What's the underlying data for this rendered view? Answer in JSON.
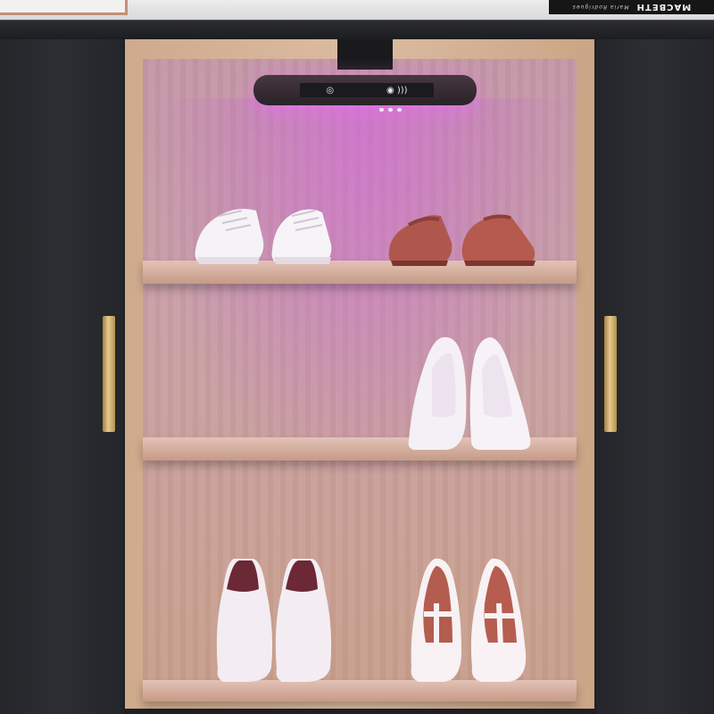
{
  "book": {
    "title": "MACBETH",
    "subtitle": "Maria Rodrigues"
  },
  "lamp": {
    "left_icon": "power-icon",
    "right_icon": "signal-icon",
    "left_glyph": "◎",
    "right_glyph": "◉ )))"
  },
  "colors": {
    "uv_light": "#d65ce6",
    "door": "#2a2b30",
    "wood": "#d4b29a",
    "handle": "#d4b173"
  },
  "shelves": [
    {
      "items": [
        "white-sneakers",
        "brown-leather-shoes"
      ]
    },
    {
      "items": [
        "white-high-heels"
      ]
    },
    {
      "items": [
        "white-ankle-boots",
        "white-t-strap-heels"
      ]
    }
  ]
}
